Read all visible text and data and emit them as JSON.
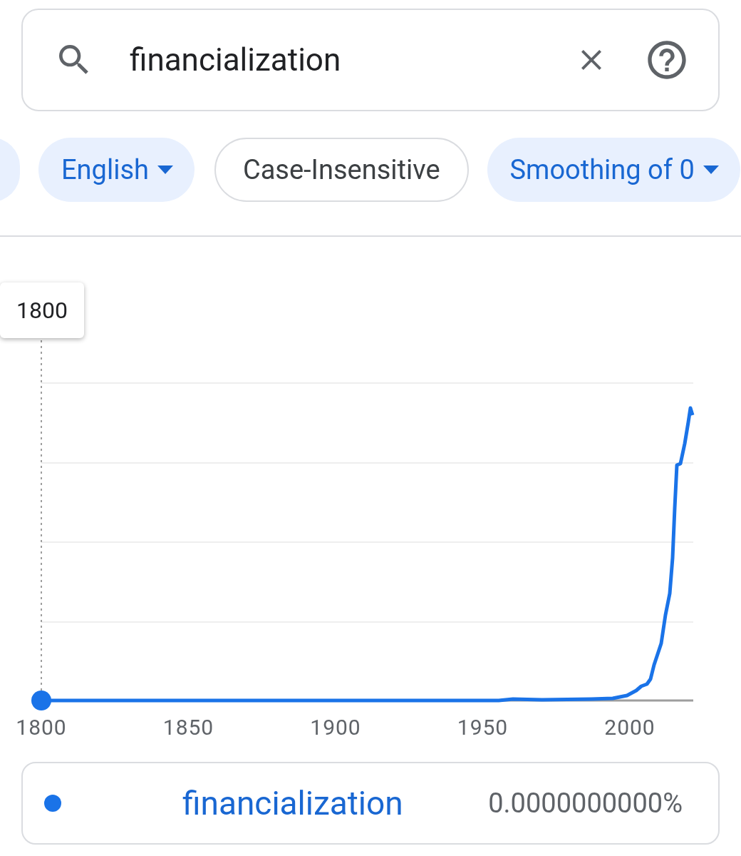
{
  "search": {
    "value": "financialization"
  },
  "chips": [
    {
      "kind": "partial"
    },
    {
      "kind": "dropdown",
      "label": "English",
      "selected": true
    },
    {
      "kind": "toggle",
      "label": "Case-Insensitive",
      "selected": false
    },
    {
      "kind": "dropdown",
      "label": "Smoothing of 0",
      "selected": true
    }
  ],
  "chart": {
    "tooltip": "1800",
    "x_labels": [
      "1800",
      "1850",
      "1900",
      "1950",
      "2000"
    ]
  },
  "legend": {
    "color": "#1a73e8",
    "term": "financialization",
    "value": "0.0000000000%"
  }
}
